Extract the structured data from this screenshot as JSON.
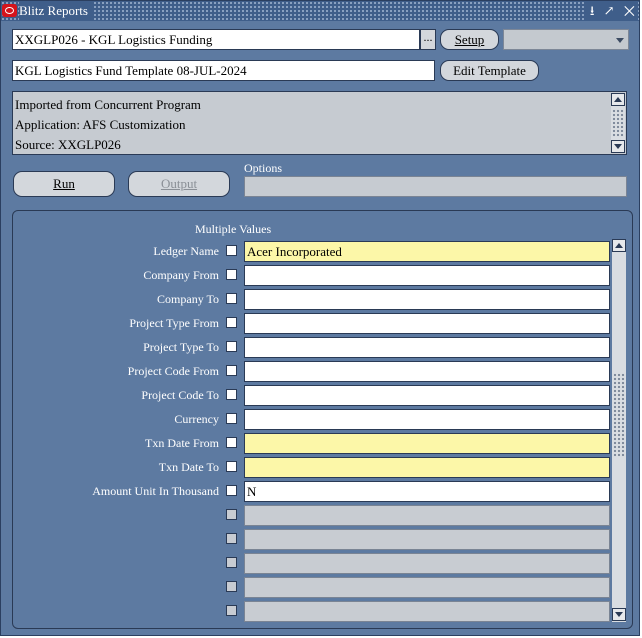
{
  "window": {
    "title": "Blitz Reports",
    "controls": "⭳ ↗ ✕"
  },
  "report": {
    "name": "XXGLP026 - KGL Logistics Funding",
    "lov_label": "...",
    "setup_label": "Setup",
    "template": "KGL Logistics Fund Template 08-JUL-2024",
    "edit_template_label": "Edit Template",
    "combo_value": ""
  },
  "info": {
    "lines": [
      "Imported from Concurrent Program",
      "Application: AFS Customization",
      "Source: XXGLP026"
    ]
  },
  "actions": {
    "run_label": "Run",
    "output_label": "Output",
    "options_label": "Options",
    "options_value": ""
  },
  "params": {
    "header": "Multiple Values",
    "rows": [
      {
        "label": "Ledger Name",
        "value": "Acer Incorporated",
        "state": "required"
      },
      {
        "label": "Company From",
        "value": "",
        "state": "normal"
      },
      {
        "label": "Company To",
        "value": "",
        "state": "normal"
      },
      {
        "label": "Project Type From",
        "value": "",
        "state": "normal"
      },
      {
        "label": "Project Type To",
        "value": "",
        "state": "normal"
      },
      {
        "label": "Project Code From",
        "value": "",
        "state": "normal"
      },
      {
        "label": "Project Code To",
        "value": "",
        "state": "normal"
      },
      {
        "label": "Currency",
        "value": "",
        "state": "normal"
      },
      {
        "label": "Txn Date From",
        "value": "",
        "state": "required"
      },
      {
        "label": "Txn Date To",
        "value": "",
        "state": "required"
      },
      {
        "label": "Amount Unit In Thousand",
        "value": "N",
        "state": "normal"
      },
      {
        "label": "",
        "value": "",
        "state": "disabled"
      },
      {
        "label": "",
        "value": "",
        "state": "disabled"
      },
      {
        "label": "",
        "value": "",
        "state": "disabled"
      },
      {
        "label": "",
        "value": "",
        "state": "disabled"
      },
      {
        "label": "",
        "value": "",
        "state": "disabled"
      }
    ]
  },
  "colors": {
    "background": "#5d7aa1",
    "required_field": "#fcf7a8",
    "disabled_field": "#c8ccd2",
    "title_logo": "#d4141c"
  }
}
